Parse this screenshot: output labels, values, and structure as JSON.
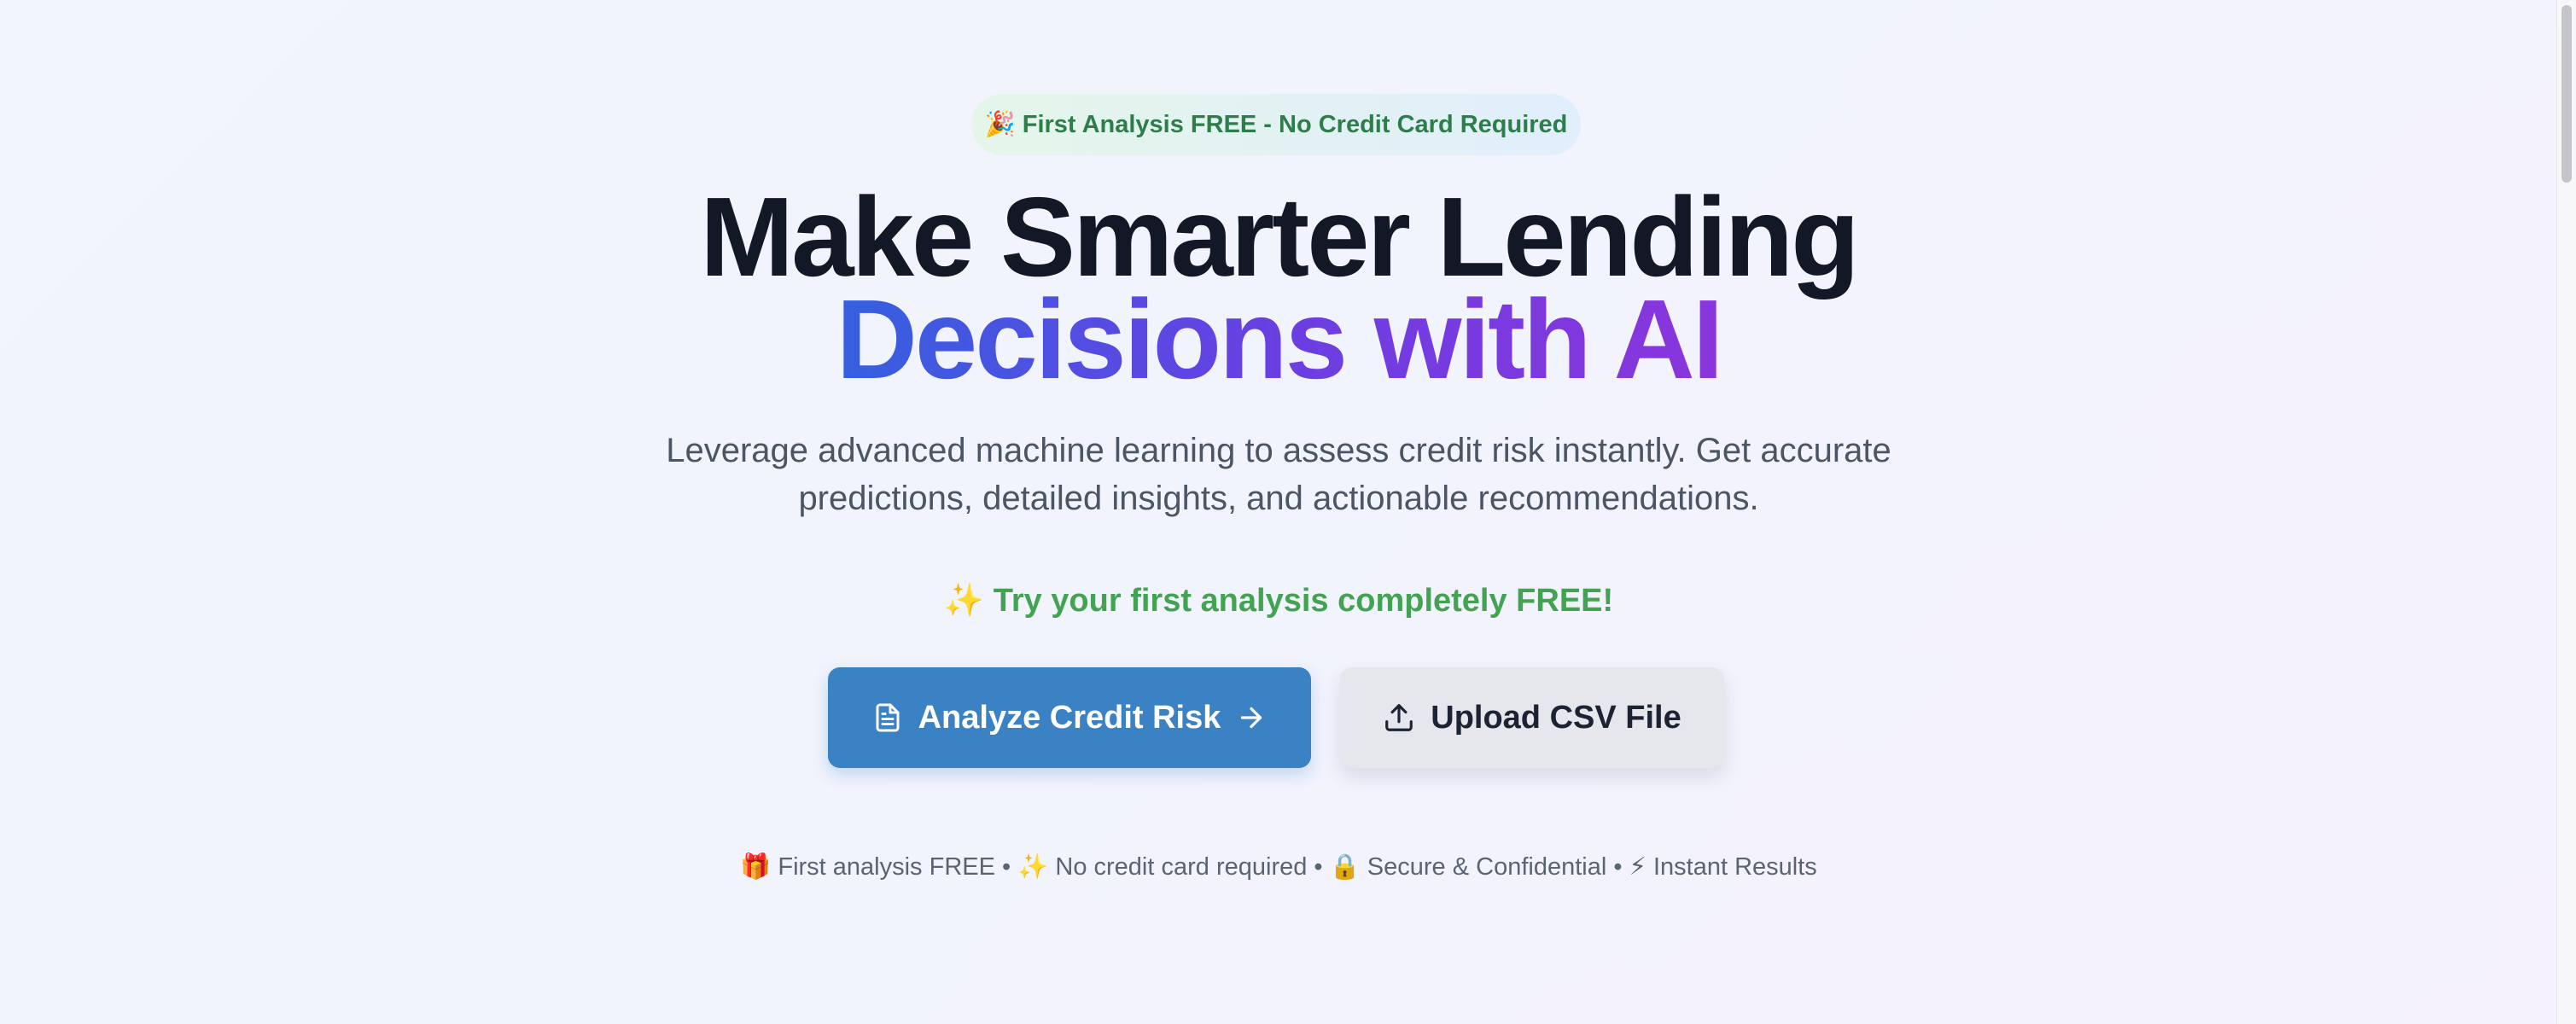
{
  "hero": {
    "badge": "🎉 First Analysis FREE - No Credit Card Required",
    "title_line1": "Make Smarter Lending",
    "title_line2": "Decisions with AI",
    "subtitle": "Leverage advanced machine learning to assess credit risk instantly. Get accurate predictions, detailed insights, and actionable recommendations.",
    "promo": "✨ Try your first analysis completely FREE!",
    "primary_button": {
      "label": "Analyze Credit Risk",
      "icon_left": "document-icon",
      "icon_right": "arrow-right-icon"
    },
    "secondary_button": {
      "label": "Upload CSV File",
      "icon_left": "upload-icon"
    },
    "features": "🎁 First analysis FREE • ✨ No credit card required • 🔒 Secure & Confidential • ⚡ Instant Results"
  },
  "colors": {
    "primary_button": "#3b82c4",
    "secondary_button": "#e6e7ec",
    "promo_text": "#43a352",
    "badge_text": "#2e7d4a",
    "gradient_start": "#3560e0",
    "gradient_end": "#8a35dc"
  }
}
